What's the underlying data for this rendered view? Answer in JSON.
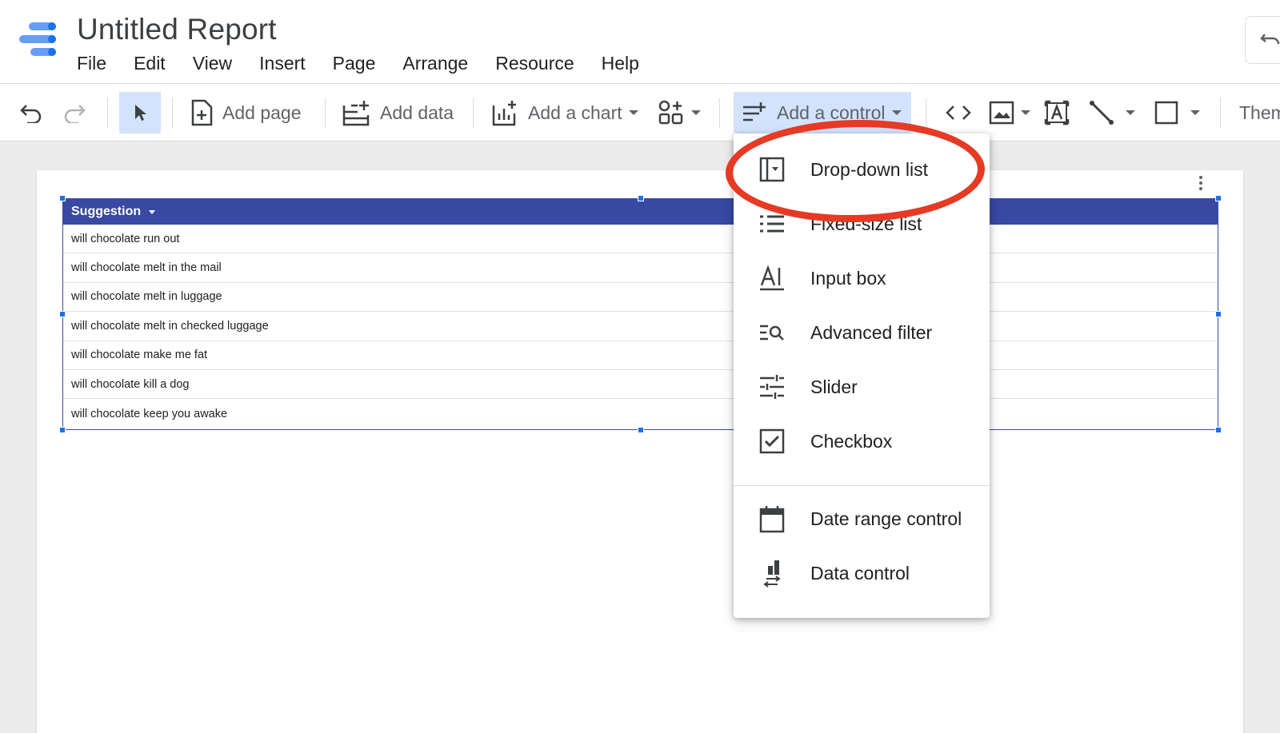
{
  "app": {
    "title": "Untitled Report"
  },
  "menubar": {
    "items": [
      "File",
      "Edit",
      "View",
      "Insert",
      "Page",
      "Arrange",
      "Resource",
      "Help"
    ]
  },
  "toolbar": {
    "add_page_label": "Add page",
    "add_data_label": "Add data",
    "add_chart_label": "Add a chart",
    "add_control_label": "Add a control",
    "theme_label": "Them"
  },
  "table": {
    "header": "Suggestion",
    "rows": [
      "will chocolate run out",
      "will chocolate melt in the mail",
      "will chocolate melt in luggage",
      "will chocolate melt in checked luggage",
      "will chocolate make me fat",
      "will chocolate kill a dog",
      "will chocolate keep you awake"
    ]
  },
  "control_menu": {
    "items": [
      {
        "label": "Drop-down list",
        "icon": "dropdown-list-icon",
        "highlighted": true
      },
      {
        "label": "Fixed-size list",
        "icon": "list-icon"
      },
      {
        "label": "Input box",
        "icon": "input-box-icon"
      },
      {
        "label": "Advanced filter",
        "icon": "advanced-filter-icon"
      },
      {
        "label": "Slider",
        "icon": "slider-icon"
      },
      {
        "label": "Checkbox",
        "icon": "checkbox-icon"
      },
      {
        "label": "Date range control",
        "icon": "calendar-icon"
      },
      {
        "label": "Data control",
        "icon": "data-control-icon"
      }
    ]
  },
  "colors": {
    "accent": "#1a73e8",
    "table_header": "#3949a3",
    "active_tool": "#d2e3fc",
    "highlight_ring": "#e53a24"
  }
}
